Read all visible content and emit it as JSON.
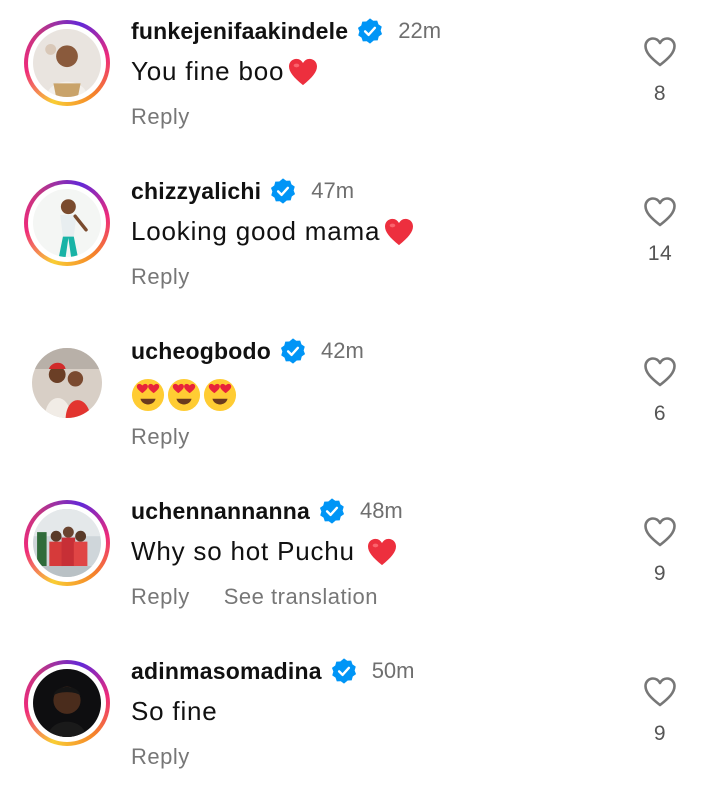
{
  "comments": [
    {
      "username": "funkejenifaakindele",
      "time": "22m",
      "text": "You fine boo",
      "emoji": "red-heart",
      "reply_label": "Reply",
      "likes": "8",
      "story_ring": true
    },
    {
      "username": "chizzyalichi",
      "time": "47m",
      "text": "Looking good mama",
      "emoji": "red-heart",
      "reply_label": "Reply",
      "likes": "14",
      "story_ring": true
    },
    {
      "username": "ucheogbodo",
      "time": "42m",
      "text": "😍😍😍",
      "emoji": "heart-eyes",
      "reply_label": "Reply",
      "likes": "6",
      "story_ring": false
    },
    {
      "username": "uchennannanna",
      "time": "48m",
      "text": "Why so hot Puchu ",
      "emoji": "red-heart",
      "reply_label": "Reply",
      "translation_label": "See translation",
      "likes": "9",
      "story_ring": true
    },
    {
      "username": "adinmasomadina",
      "time": "50m",
      "text": "So fine",
      "reply_label": "Reply",
      "likes": "9",
      "story_ring": true
    }
  ],
  "colors": {
    "verified": "#0095f6",
    "heart": "#ed2f3e",
    "secondary_text": "#6f6f6f"
  }
}
